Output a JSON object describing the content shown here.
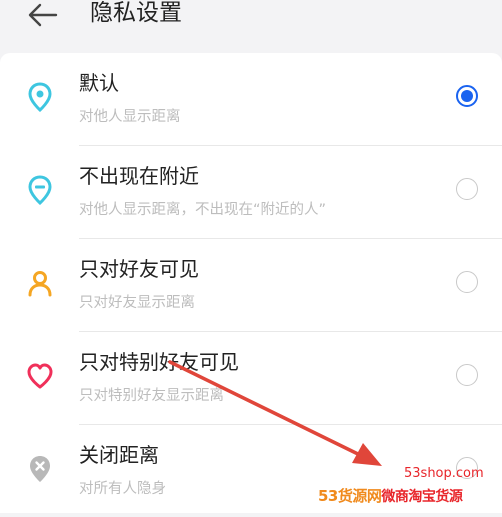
{
  "header": {
    "title": "隐私设置"
  },
  "options": [
    {
      "label": "默认",
      "desc": "对他人显示距离",
      "selected": true,
      "icon": "location-pin-icon",
      "icon_color": "#3ec6e0"
    },
    {
      "label": "不出现在附近",
      "desc": "对他人显示距离，不出现在“附近的人”",
      "selected": false,
      "icon": "location-pin-minus-icon",
      "icon_color": "#3ec6e0"
    },
    {
      "label": "只对好友可见",
      "desc": "只对好友显示距离",
      "selected": false,
      "icon": "person-icon",
      "icon_color": "#f5a623"
    },
    {
      "label": "只对特别好友可见",
      "desc": "只对特别好友显示距离",
      "selected": false,
      "icon": "heart-icon",
      "icon_color": "#f0305a"
    },
    {
      "label": "关闭距离",
      "desc": "对所有人隐身",
      "selected": false,
      "icon": "location-pin-off-icon",
      "icon_color": "#b8b8b8"
    }
  ],
  "watermark": {
    "domain": "53shop.com",
    "brand": "53货源网",
    "tagline": "微商淘宝货源"
  },
  "colors": {
    "accent": "#1a63f0",
    "arrow": "#e0463a"
  }
}
